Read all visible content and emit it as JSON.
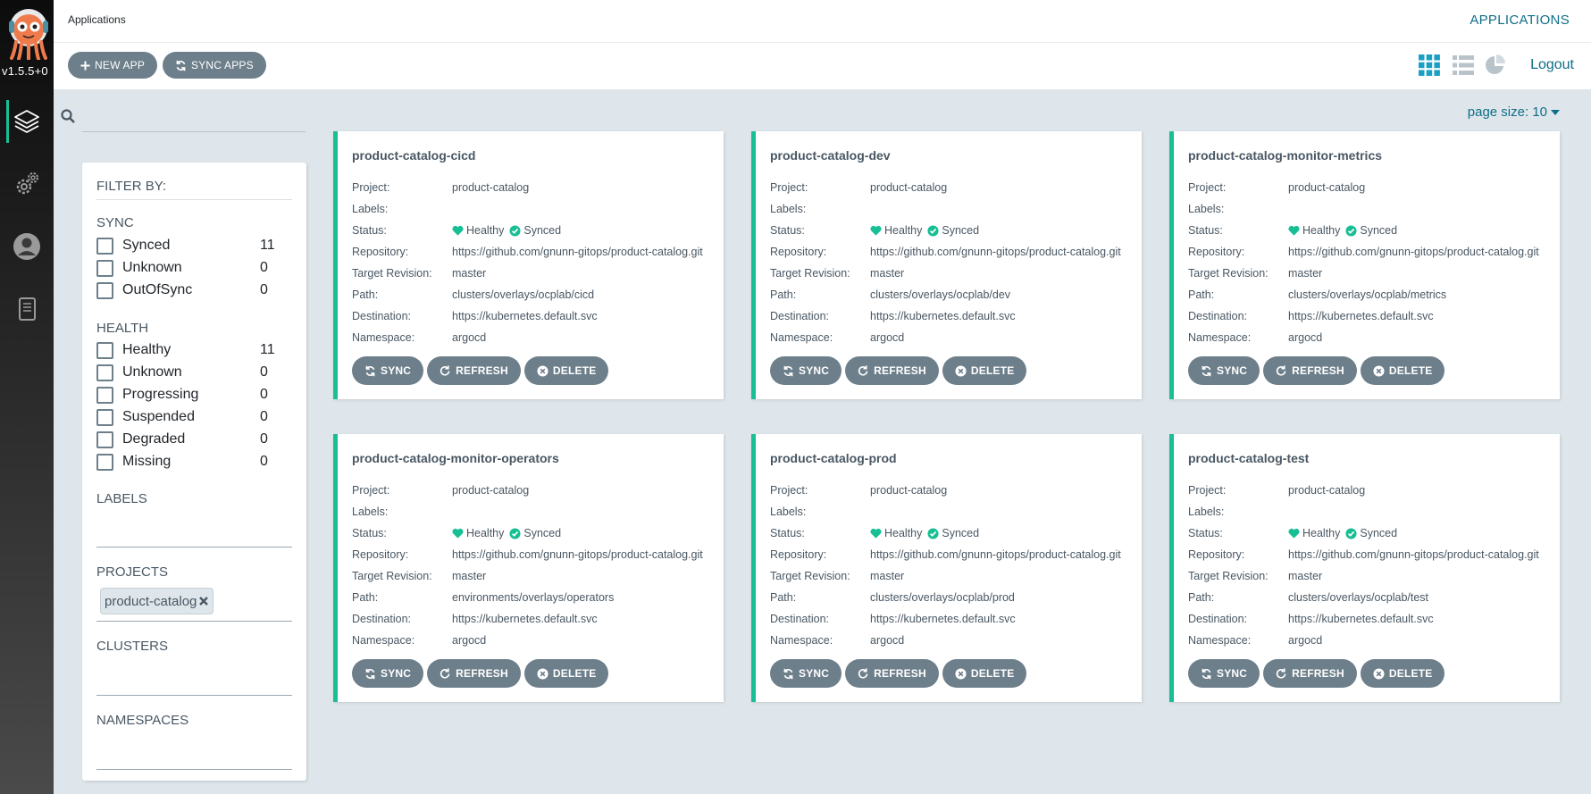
{
  "nav": {
    "version": "v1.5.5+0",
    "items": [
      "applications",
      "settings",
      "user-info",
      "docs"
    ]
  },
  "topbar": {
    "breadcrumb": "Applications",
    "title": "APPLICATIONS"
  },
  "toolbar": {
    "new_app": "NEW APP",
    "sync_apps": "SYNC APPS",
    "logout": "Logout"
  },
  "search": {
    "placeholder": ""
  },
  "pagination": {
    "page_size_label": "page size: 10"
  },
  "filters": {
    "header": "FILTER BY:",
    "sync": {
      "title": "SYNC",
      "items": [
        {
          "label": "Synced",
          "count": "11"
        },
        {
          "label": "Unknown",
          "count": "0"
        },
        {
          "label": "OutOfSync",
          "count": "0"
        }
      ]
    },
    "health": {
      "title": "HEALTH",
      "items": [
        {
          "label": "Healthy",
          "count": "11"
        },
        {
          "label": "Unknown",
          "count": "0"
        },
        {
          "label": "Progressing",
          "count": "0"
        },
        {
          "label": "Suspended",
          "count": "0"
        },
        {
          "label": "Degraded",
          "count": "0"
        },
        {
          "label": "Missing",
          "count": "0"
        }
      ]
    },
    "labels_title": "LABELS",
    "projects_title": "PROJECTS",
    "project_chip": "product-catalog",
    "clusters_title": "CLUSTERS",
    "namespaces_title": "NAMESPACES"
  },
  "card_labels": {
    "project": "Project:",
    "labels": "Labels:",
    "status": "Status:",
    "repository": "Repository:",
    "target": "Target Revision:",
    "path": "Path:",
    "destination": "Destination:",
    "namespace": "Namespace:",
    "healthy": "Healthy",
    "synced": "Synced",
    "sync_btn": "SYNC",
    "refresh_btn": "REFRESH",
    "delete_btn": "DELETE"
  },
  "apps": [
    {
      "name": "product-catalog-cicd",
      "project": "product-catalog",
      "labels": "",
      "repo": "https://github.com/gnunn-gitops/product-catalog.git",
      "revision": "master",
      "path": "clusters/overlays/ocplab/cicd",
      "destination": "https://kubernetes.default.svc",
      "namespace": "argocd"
    },
    {
      "name": "product-catalog-dev",
      "project": "product-catalog",
      "labels": "",
      "repo": "https://github.com/gnunn-gitops/product-catalog.git",
      "revision": "master",
      "path": "clusters/overlays/ocplab/dev",
      "destination": "https://kubernetes.default.svc",
      "namespace": "argocd"
    },
    {
      "name": "product-catalog-monitor-metrics",
      "project": "product-catalog",
      "labels": "",
      "repo": "https://github.com/gnunn-gitops/product-catalog.git",
      "revision": "master",
      "path": "clusters/overlays/ocplab/metrics",
      "destination": "https://kubernetes.default.svc",
      "namespace": "argocd"
    },
    {
      "name": "product-catalog-monitor-operators",
      "project": "product-catalog",
      "labels": "",
      "repo": "https://github.com/gnunn-gitops/product-catalog.git",
      "revision": "master",
      "path": "environments/overlays/operators",
      "destination": "https://kubernetes.default.svc",
      "namespace": "argocd"
    },
    {
      "name": "product-catalog-prod",
      "project": "product-catalog",
      "labels": "",
      "repo": "https://github.com/gnunn-gitops/product-catalog.git",
      "revision": "master",
      "path": "clusters/overlays/ocplab/prod",
      "destination": "https://kubernetes.default.svc",
      "namespace": "argocd"
    },
    {
      "name": "product-catalog-test",
      "project": "product-catalog",
      "labels": "",
      "repo": "https://github.com/gnunn-gitops/product-catalog.git",
      "revision": "master",
      "path": "clusters/overlays/ocplab/test",
      "destination": "https://kubernetes.default.svc",
      "namespace": "argocd"
    }
  ],
  "colors": {
    "accent": "#18be94",
    "link": "#0e6e87",
    "button": "#6d7f8b",
    "background": "#dee6eb"
  }
}
